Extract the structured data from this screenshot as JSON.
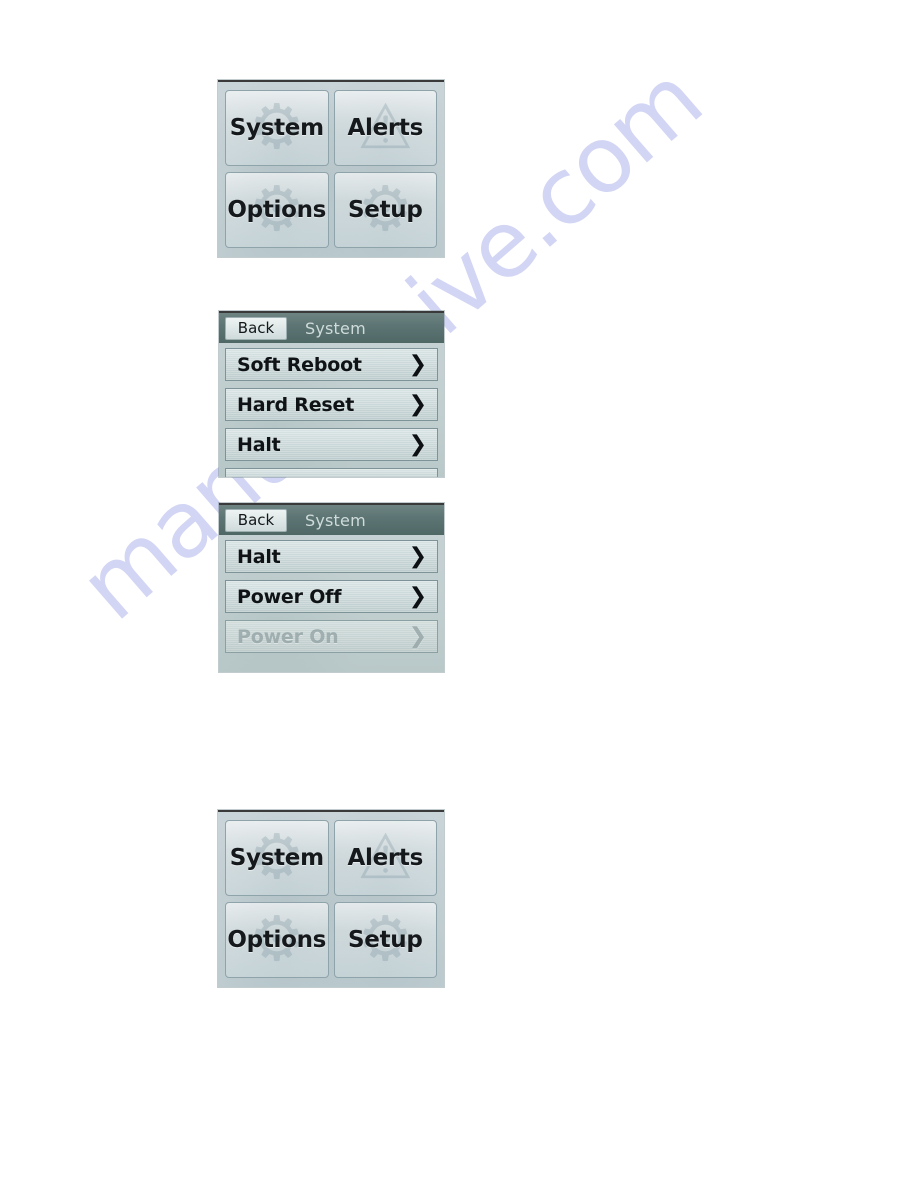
{
  "page": {
    "watermark_text": "manualshive.com",
    "watermark_color": "#c3c8ef",
    "background_color": "#ffffff"
  },
  "theme": {
    "screen_background": "#c5d1d5",
    "header_background": "#5d7574",
    "header_title_color": "#cfdcdb",
    "row_background": "#ccd9da",
    "row_border": "#7e9398",
    "text_color": "#101315",
    "disabled_text_color": "#6e8285"
  },
  "screens": [
    {
      "id": "home-screen-top",
      "type": "tile-menu",
      "tiles": [
        {
          "label": "System",
          "name": "system"
        },
        {
          "label": "Alerts",
          "name": "alerts"
        },
        {
          "label": "Options",
          "name": "options"
        },
        {
          "label": "Setup",
          "name": "setup"
        }
      ]
    },
    {
      "id": "system-menu-screen",
      "type": "list-menu",
      "header": {
        "back_label": "Back",
        "title": "System"
      },
      "rows": [
        {
          "label": "Soft Reboot",
          "name": "soft-reboot",
          "chevron": "❯",
          "disabled": false,
          "clipped": false
        },
        {
          "label": "Hard Reset",
          "name": "hard-reset",
          "chevron": "❯",
          "disabled": false,
          "clipped": false
        },
        {
          "label": "Halt",
          "name": "halt",
          "chevron": "❯",
          "disabled": false,
          "clipped": false
        },
        {
          "label": "",
          "name": "next-item-partial",
          "chevron": "",
          "disabled": false,
          "clipped": true
        }
      ]
    },
    {
      "id": "system-power-menu-screen",
      "type": "list-menu",
      "header": {
        "back_label": "Back",
        "title": "System"
      },
      "rows": [
        {
          "label": "Halt",
          "name": "halt",
          "chevron": "❯",
          "disabled": false,
          "clipped": false
        },
        {
          "label": "Power Off",
          "name": "power-off",
          "chevron": "❯",
          "disabled": false,
          "clipped": false
        },
        {
          "label": "Power On",
          "name": "power-on",
          "chevron": "❯",
          "disabled": true,
          "clipped": false
        }
      ]
    },
    {
      "id": "home-screen-bottom",
      "type": "tile-menu",
      "tiles": [
        {
          "label": "System",
          "name": "system"
        },
        {
          "label": "Alerts",
          "name": "alerts"
        },
        {
          "label": "Options",
          "name": "options"
        },
        {
          "label": "Setup",
          "name": "setup"
        }
      ]
    }
  ]
}
